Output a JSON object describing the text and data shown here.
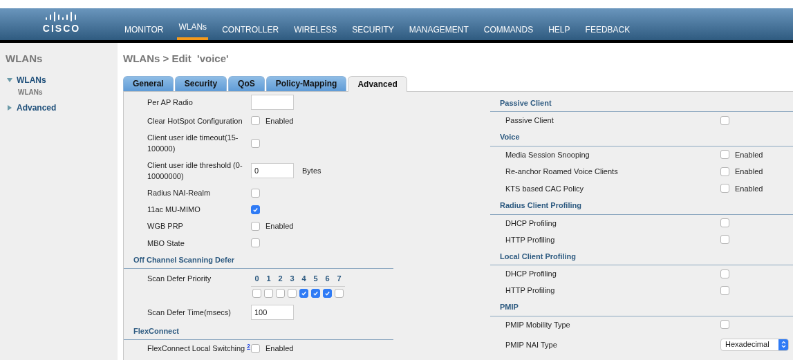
{
  "header": {
    "logo_text": "CISCO",
    "nav": [
      {
        "label": "MONITOR",
        "selected": false
      },
      {
        "label": "WLANs",
        "selected": true
      },
      {
        "label": "CONTROLLER",
        "selected": false
      },
      {
        "label": "WIRELESS",
        "selected": false
      },
      {
        "label": "SECURITY",
        "selected": false
      },
      {
        "label": "MANAGEMENT",
        "selected": false
      },
      {
        "label": "COMMANDS",
        "selected": false
      },
      {
        "label": "HELP",
        "selected": false
      },
      {
        "label": "FEEDBACK",
        "selected": false
      }
    ]
  },
  "sidebar": {
    "title": "WLANs",
    "tree": [
      {
        "label": "WLANs",
        "expanded": true,
        "children": [
          {
            "label": "WLANs"
          }
        ]
      },
      {
        "label": "Advanced",
        "expanded": false
      }
    ]
  },
  "page_title": "WLANs > Edit  'voice'",
  "tabs": [
    {
      "label": "General",
      "selected": false
    },
    {
      "label": "Security",
      "selected": false
    },
    {
      "label": "QoS",
      "selected": false
    },
    {
      "label": "Policy-Mapping",
      "selected": false
    },
    {
      "label": "Advanced",
      "selected": true
    }
  ],
  "left": [
    {
      "kind": "input",
      "label": "Per AP Radio"
    },
    {
      "kind": "checkbox",
      "label": "Clear HotSpot Configuration",
      "checked": false,
      "suffix": "Enabled"
    },
    {
      "kind": "checkbox",
      "label": "Client user idle timeout(15-100000)",
      "checked": false
    },
    {
      "kind": "input",
      "label": "Client user idle threshold (0-10000000)",
      "value": "0",
      "suffix": "Bytes"
    },
    {
      "kind": "checkbox",
      "label": "Radius NAI-Realm",
      "checked": false
    },
    {
      "kind": "checkbox",
      "label": "11ac MU-MIMO",
      "checked": true
    },
    {
      "kind": "checkbox",
      "label": "WGB PRP",
      "checked": false,
      "suffix": "Enabled"
    },
    {
      "kind": "checkbox",
      "label": "MBO State",
      "checked": false
    },
    {
      "kind": "section",
      "label": "Off Channel Scanning Defer"
    },
    {
      "kind": "priority",
      "label": "Scan Defer Priority",
      "priorities": [
        {
          "label": "0",
          "checked": false
        },
        {
          "label": "1",
          "checked": false
        },
        {
          "label": "2",
          "checked": false
        },
        {
          "label": "3",
          "checked": false
        },
        {
          "label": "4",
          "checked": true
        },
        {
          "label": "5",
          "checked": true
        },
        {
          "label": "6",
          "checked": true
        },
        {
          "label": "7",
          "checked": false
        }
      ]
    },
    {
      "kind": "input",
      "label": "Scan Defer Time(msecs)",
      "value": "100"
    },
    {
      "kind": "section",
      "label": "FlexConnect"
    },
    {
      "kind": "checkbox",
      "label": "FlexConnect Local Switching",
      "note": "2",
      "checked": false,
      "suffix": "Enabled"
    }
  ],
  "right": [
    {
      "kind": "section",
      "label": "Passive Client"
    },
    {
      "kind": "checkbox",
      "label": "Passive Client",
      "checked": false
    },
    {
      "kind": "section",
      "label": "Voice"
    },
    {
      "kind": "checkbox",
      "label": "Media Session Snooping",
      "checked": false,
      "suffix": "Enabled"
    },
    {
      "kind": "checkbox",
      "label": "Re-anchor Roamed Voice Clients",
      "checked": false,
      "suffix": "Enabled"
    },
    {
      "kind": "checkbox",
      "label": "KTS based CAC Policy",
      "checked": false,
      "suffix": "Enabled"
    },
    {
      "kind": "section",
      "label": "Radius Client Profiling"
    },
    {
      "kind": "checkbox",
      "label": "DHCP Profiling",
      "checked": false
    },
    {
      "kind": "checkbox",
      "label": "HTTP Profiling",
      "checked": false
    },
    {
      "kind": "section",
      "label": "Local Client Profiling"
    },
    {
      "kind": "checkbox",
      "label": "DHCP Profiling",
      "checked": false
    },
    {
      "kind": "checkbox",
      "label": "HTTP Profiling",
      "checked": false
    },
    {
      "kind": "section",
      "label": "PMIP"
    },
    {
      "kind": "checkbox",
      "label": "PMIP Mobility Type",
      "checked": false
    },
    {
      "kind": "select",
      "label": "PMIP NAI Type",
      "value": "Hexadecimal"
    }
  ]
}
